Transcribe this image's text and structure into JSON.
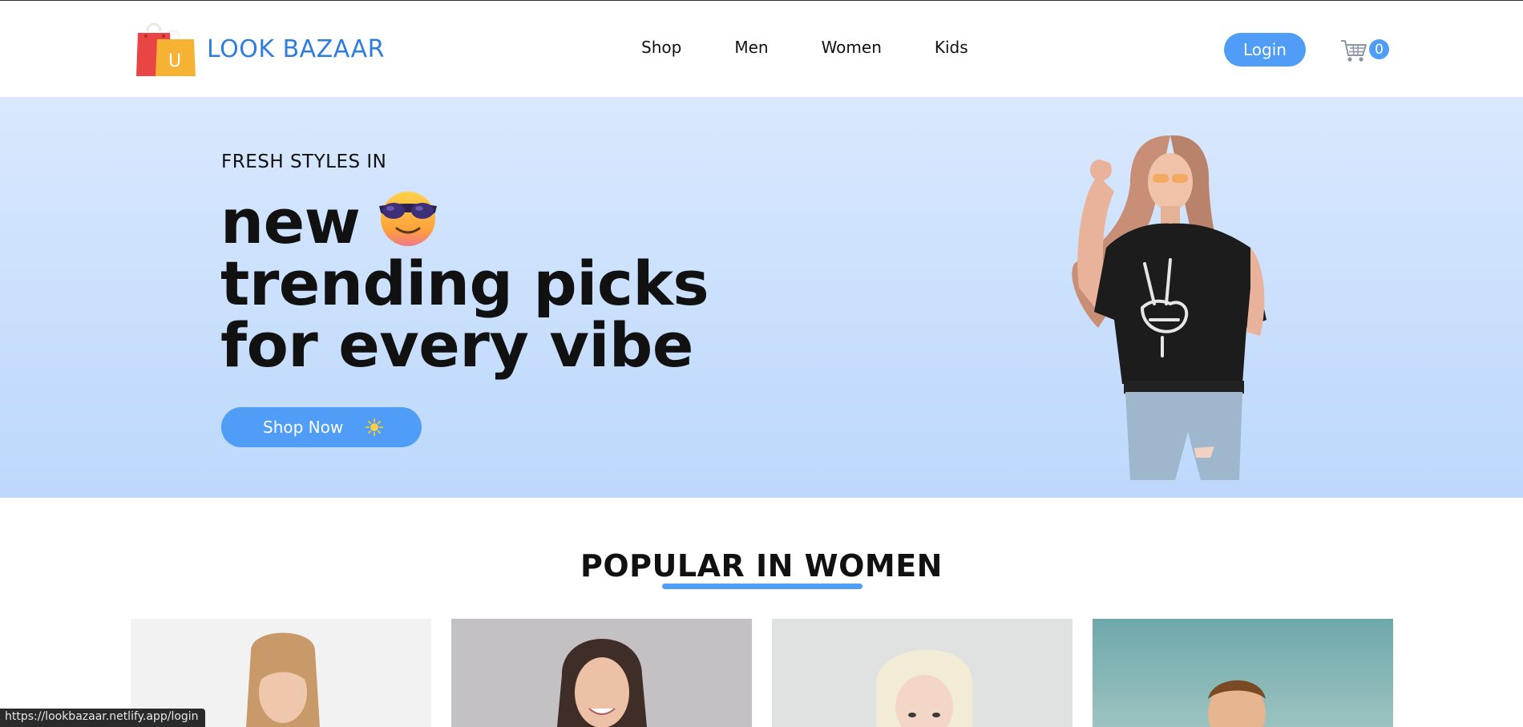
{
  "brand": {
    "name": "LOOK BAZAAR",
    "bag_letter": "U"
  },
  "nav": {
    "items": [
      "Shop",
      "Men",
      "Women",
      "Kids"
    ]
  },
  "header": {
    "login_label": "Login",
    "cart_count": "0"
  },
  "hero": {
    "eyebrow": "FRESH STYLES IN",
    "title_line1": "new",
    "title_line2": "trending picks",
    "title_line3": "for every vibe",
    "cta_label": "Shop Now"
  },
  "section": {
    "title": "POPULAR IN WOMEN"
  },
  "status_bar": {
    "url": "https://lookbazaar.netlify.app/login"
  },
  "colors": {
    "accent": "#4f9df6",
    "brand": "#2f7de1",
    "hero_top": "#d9e8fd",
    "hero_bottom": "#bcd8fc"
  },
  "icons": [
    "shopping-bag-logo-icon",
    "cart-icon",
    "sunglasses-emoji-icon",
    "sun-emoji-icon"
  ]
}
